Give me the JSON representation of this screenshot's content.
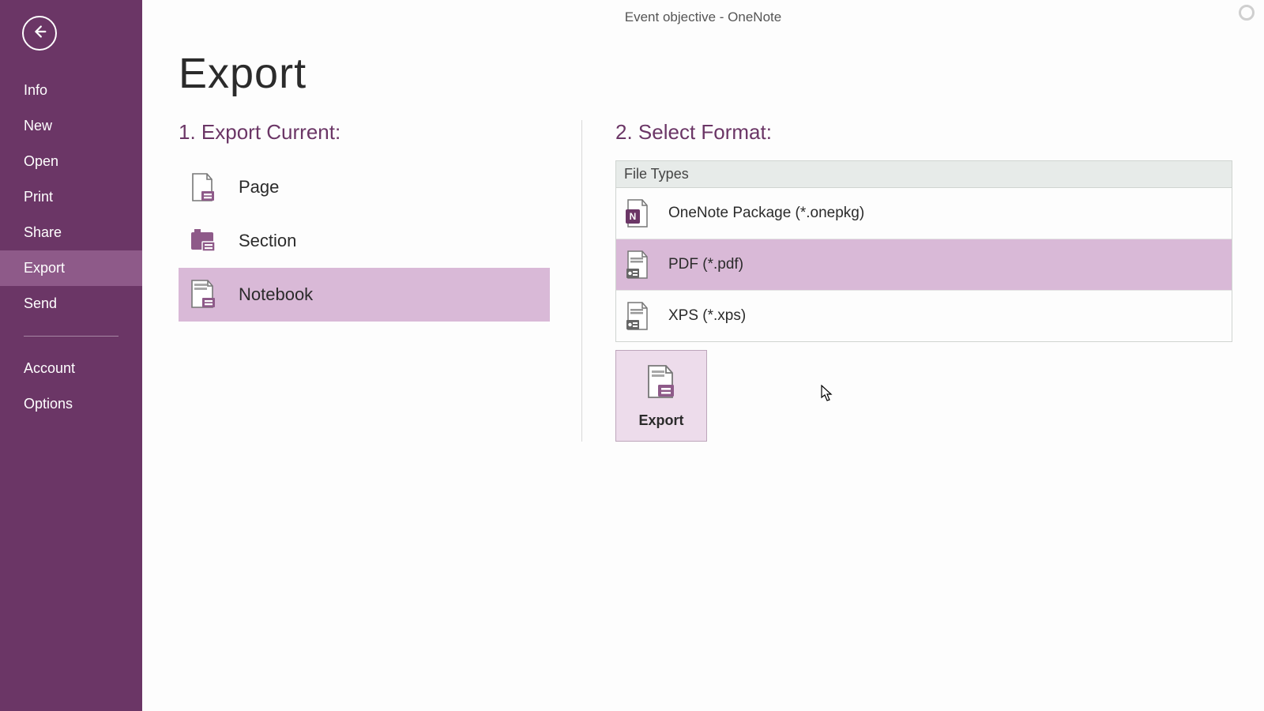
{
  "titlebar": "Event objective - OneNote",
  "page_title": "Export",
  "sidebar": {
    "items": [
      "Info",
      "New",
      "Open",
      "Print",
      "Share",
      "Export",
      "Send"
    ],
    "footer": [
      "Account",
      "Options"
    ],
    "active_index": 5
  },
  "col1": {
    "heading": "1. Export Current:",
    "items": [
      {
        "label": "Page"
      },
      {
        "label": "Section"
      },
      {
        "label": "Notebook"
      }
    ],
    "selected_index": 2
  },
  "col2": {
    "heading": "2. Select Format:",
    "group_label": "File Types",
    "items": [
      {
        "label": "OneNote Package (*.onepkg)"
      },
      {
        "label": "PDF (*.pdf)"
      },
      {
        "label": "XPS (*.xps)"
      }
    ],
    "selected_index": 1,
    "export_btn_label": "Export"
  },
  "colors": {
    "accent": "#6b3666",
    "selection": "#d9b9d7"
  }
}
